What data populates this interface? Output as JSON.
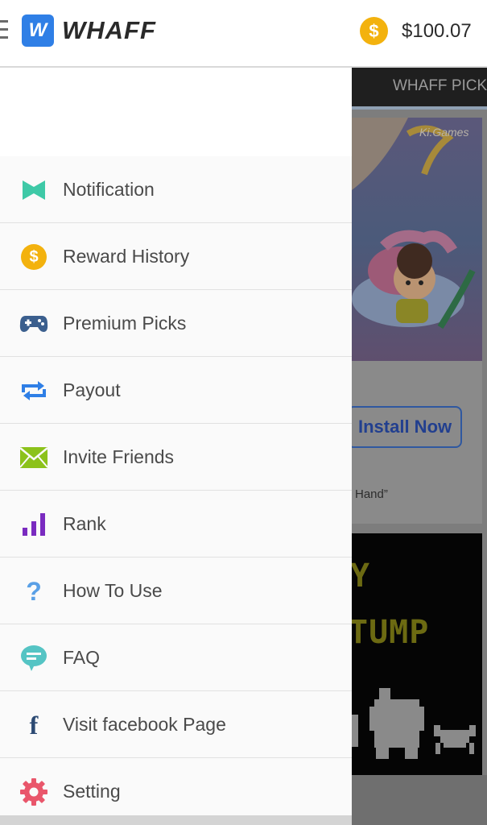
{
  "app": {
    "logo_letter": "W",
    "logo_text": "WHAFF",
    "coin_symbol": "$",
    "balance": "$100.07"
  },
  "background": {
    "tab_label": "WHAFF PICK",
    "banner_brand": "Ki.Games",
    "install_label": "Install Now",
    "quote_fragment": "Hand”",
    "pixel_line_1": "Y",
    "pixel_line_2": "TUMP"
  },
  "menu": {
    "items": [
      {
        "label": "Notification",
        "icon": "notification-icon",
        "color": "#3ec9a7"
      },
      {
        "label": "Reward History",
        "icon": "coin-icon",
        "color": "#f3b20e"
      },
      {
        "label": "Premium Picks",
        "icon": "gamepad-icon",
        "color": "#3b5f8e"
      },
      {
        "label": "Payout",
        "icon": "payout-icon",
        "color": "#2f7fe6"
      },
      {
        "label": "Invite Friends",
        "icon": "envelope-icon",
        "color": "#8cc21b"
      },
      {
        "label": "Rank",
        "icon": "rank-icon",
        "color": "#7a2bc0"
      },
      {
        "label": "How To Use",
        "icon": "question-icon",
        "color": "#5aa0e6"
      },
      {
        "label": "FAQ",
        "icon": "faq-icon",
        "color": "#55c4c4"
      },
      {
        "label": "Visit facebook Page",
        "icon": "facebook-icon",
        "color": "#2c4a73"
      },
      {
        "label": "Setting",
        "icon": "gear-icon",
        "color": "#e9566b"
      }
    ],
    "coin_symbol": "$",
    "question_symbol": "?",
    "facebook_symbol": "f"
  }
}
